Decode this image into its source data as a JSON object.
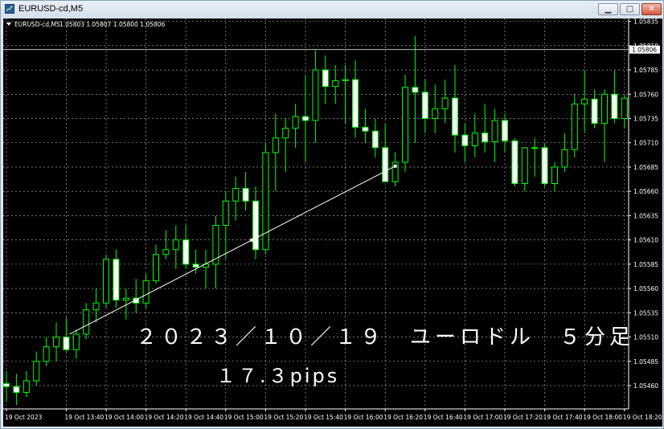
{
  "window": {
    "title": "EURUSD-cd,M5",
    "buttons": {
      "minimize": "▁",
      "maximize": "□",
      "close": "✕"
    }
  },
  "header": {
    "symbol": "EURUSD-cd,M5",
    "ohlc": "1.05803 1.05807 1.05800 1.05806"
  },
  "current_price": "1.05806",
  "annotation": {
    "title": "２０２３／１０／１９　ユーロドル　５分足",
    "pips": "１７.３pips"
  },
  "colors": {
    "background": "#000000",
    "candle_border": "#00ff00",
    "bull_body": "#000000",
    "bear_body": "#ffffff",
    "grid": "#c0c0c0",
    "axis_text": "#ffffff",
    "price_line": "#c0c0c0",
    "trend_line": "#ffffff"
  },
  "chart_data": {
    "type": "candlestick",
    "timeframe": "M5",
    "y_ticks": [
      "1.05460",
      "1.05485",
      "1.05510",
      "1.05535",
      "1.05560",
      "1.05585",
      "1.05610",
      "1.05635",
      "1.05660",
      "1.05685",
      "1.05710",
      "1.05735",
      "1.05760",
      "1.05785",
      "1.05810",
      "1.05835"
    ],
    "ylim": [
      1.05436,
      1.05838
    ],
    "x_labels": [
      "19 Oct 2023",
      "19 Oct 13:40",
      "19 Oct 14:00",
      "19 Oct 14:20",
      "19 Oct 14:40",
      "19 Oct 15:00",
      "19 Oct 15:20",
      "19 Oct 15:40",
      "19 Oct 16:00",
      "19 Oct 16:20",
      "19 Oct 16:40",
      "19 Oct 17:00",
      "19 Oct 17:20",
      "19 Oct 17:40",
      "19 Oct 18:00",
      "19 Oct 18:20"
    ],
    "x_label_candle_index": [
      0,
      6,
      10,
      14,
      18,
      22,
      26,
      30,
      34,
      38,
      42,
      46,
      50,
      54,
      58,
      62
    ],
    "grid": true,
    "candles": [
      {
        "o": 1.05462,
        "h": 1.05475,
        "l": 1.05443,
        "c": 1.05459
      },
      {
        "o": 1.05459,
        "h": 1.05472,
        "l": 1.0544,
        "c": 1.05453
      },
      {
        "o": 1.05453,
        "h": 1.05475,
        "l": 1.05448,
        "c": 1.05465
      },
      {
        "o": 1.05465,
        "h": 1.05495,
        "l": 1.0546,
        "c": 1.05485
      },
      {
        "o": 1.05485,
        "h": 1.0551,
        "l": 1.0548,
        "c": 1.055
      },
      {
        "o": 1.055,
        "h": 1.05525,
        "l": 1.05485,
        "c": 1.0551
      },
      {
        "o": 1.0551,
        "h": 1.0553,
        "l": 1.05495,
        "c": 1.05497
      },
      {
        "o": 1.05497,
        "h": 1.05518,
        "l": 1.05488,
        "c": 1.05513
      },
      {
        "o": 1.05513,
        "h": 1.05545,
        "l": 1.05508,
        "c": 1.05538
      },
      {
        "o": 1.05538,
        "h": 1.0556,
        "l": 1.05525,
        "c": 1.05545
      },
      {
        "o": 1.05545,
        "h": 1.05595,
        "l": 1.0554,
        "c": 1.0559
      },
      {
        "o": 1.0559,
        "h": 1.056,
        "l": 1.0554,
        "c": 1.05548
      },
      {
        "o": 1.05548,
        "h": 1.0556,
        "l": 1.05528,
        "c": 1.0555
      },
      {
        "o": 1.0555,
        "h": 1.0557,
        "l": 1.05535,
        "c": 1.05545
      },
      {
        "o": 1.05545,
        "h": 1.05575,
        "l": 1.0554,
        "c": 1.05568
      },
      {
        "o": 1.05568,
        "h": 1.05605,
        "l": 1.05565,
        "c": 1.05595
      },
      {
        "o": 1.05595,
        "h": 1.0562,
        "l": 1.0559,
        "c": 1.056
      },
      {
        "o": 1.056,
        "h": 1.05625,
        "l": 1.0558,
        "c": 1.0561
      },
      {
        "o": 1.0561,
        "h": 1.05625,
        "l": 1.0558,
        "c": 1.05585
      },
      {
        "o": 1.05585,
        "h": 1.056,
        "l": 1.05575,
        "c": 1.05582
      },
      {
        "o": 1.05582,
        "h": 1.056,
        "l": 1.0556,
        "c": 1.05585
      },
      {
        "o": 1.05585,
        "h": 1.05635,
        "l": 1.0556,
        "c": 1.05625
      },
      {
        "o": 1.05625,
        "h": 1.0566,
        "l": 1.0559,
        "c": 1.0565
      },
      {
        "o": 1.0565,
        "h": 1.05675,
        "l": 1.0563,
        "c": 1.05663
      },
      {
        "o": 1.05663,
        "h": 1.0568,
        "l": 1.0564,
        "c": 1.0565
      },
      {
        "o": 1.0565,
        "h": 1.05665,
        "l": 1.0559,
        "c": 1.056
      },
      {
        "o": 1.056,
        "h": 1.0571,
        "l": 1.05595,
        "c": 1.057
      },
      {
        "o": 1.057,
        "h": 1.0574,
        "l": 1.0566,
        "c": 1.05715
      },
      {
        "o": 1.05715,
        "h": 1.05735,
        "l": 1.0568,
        "c": 1.05725
      },
      {
        "o": 1.05725,
        "h": 1.0575,
        "l": 1.05705,
        "c": 1.05737
      },
      {
        "o": 1.05737,
        "h": 1.0578,
        "l": 1.0569,
        "c": 1.05733
      },
      {
        "o": 1.05733,
        "h": 1.05805,
        "l": 1.0571,
        "c": 1.05785
      },
      {
        "o": 1.05785,
        "h": 1.058,
        "l": 1.0575,
        "c": 1.05768
      },
      {
        "o": 1.05768,
        "h": 1.0579,
        "l": 1.0575,
        "c": 1.05774
      },
      {
        "o": 1.05774,
        "h": 1.0579,
        "l": 1.0573,
        "c": 1.05775
      },
      {
        "o": 1.05775,
        "h": 1.05795,
        "l": 1.05715,
        "c": 1.05726
      },
      {
        "o": 1.05726,
        "h": 1.05745,
        "l": 1.0571,
        "c": 1.05722
      },
      {
        "o": 1.05722,
        "h": 1.05735,
        "l": 1.05695,
        "c": 1.05705
      },
      {
        "o": 1.05705,
        "h": 1.0573,
        "l": 1.05685,
        "c": 1.0567
      },
      {
        "o": 1.0567,
        "h": 1.057,
        "l": 1.05665,
        "c": 1.0569
      },
      {
        "o": 1.0569,
        "h": 1.0578,
        "l": 1.0568,
        "c": 1.05767
      },
      {
        "o": 1.05767,
        "h": 1.0582,
        "l": 1.0571,
        "c": 1.05762
      },
      {
        "o": 1.05762,
        "h": 1.05775,
        "l": 1.0572,
        "c": 1.05735
      },
      {
        "o": 1.05735,
        "h": 1.0577,
        "l": 1.0572,
        "c": 1.05745
      },
      {
        "o": 1.05745,
        "h": 1.05775,
        "l": 1.0573,
        "c": 1.05756
      },
      {
        "o": 1.05756,
        "h": 1.0579,
        "l": 1.057,
        "c": 1.05718
      },
      {
        "o": 1.05718,
        "h": 1.0573,
        "l": 1.0569,
        "c": 1.05707
      },
      {
        "o": 1.05707,
        "h": 1.0574,
        "l": 1.05695,
        "c": 1.0572
      },
      {
        "o": 1.0572,
        "h": 1.0575,
        "l": 1.057,
        "c": 1.05711
      },
      {
        "o": 1.05711,
        "h": 1.05745,
        "l": 1.0569,
        "c": 1.05733
      },
      {
        "o": 1.05733,
        "h": 1.0574,
        "l": 1.057,
        "c": 1.05712
      },
      {
        "o": 1.05712,
        "h": 1.05715,
        "l": 1.05665,
        "c": 1.05668
      },
      {
        "o": 1.05668,
        "h": 1.057,
        "l": 1.0566,
        "c": 1.05705
      },
      {
        "o": 1.05705,
        "h": 1.05715,
        "l": 1.05675,
        "c": 1.05705
      },
      {
        "o": 1.05705,
        "h": 1.0571,
        "l": 1.05665,
        "c": 1.05668
      },
      {
        "o": 1.05668,
        "h": 1.0569,
        "l": 1.0566,
        "c": 1.05685
      },
      {
        "o": 1.05685,
        "h": 1.0572,
        "l": 1.0568,
        "c": 1.05703
      },
      {
        "o": 1.05703,
        "h": 1.0576,
        "l": 1.05695,
        "c": 1.0575
      },
      {
        "o": 1.0575,
        "h": 1.05785,
        "l": 1.0572,
        "c": 1.05755
      },
      {
        "o": 1.05755,
        "h": 1.05765,
        "l": 1.05725,
        "c": 1.0573
      },
      {
        "o": 1.0573,
        "h": 1.05765,
        "l": 1.0569,
        "c": 1.0576
      },
      {
        "o": 1.0576,
        "h": 1.05785,
        "l": 1.0573,
        "c": 1.05735
      },
      {
        "o": 1.05735,
        "h": 1.0576,
        "l": 1.05725,
        "c": 1.05756
      }
    ],
    "trend_line": {
      "from_index": 6,
      "from_price": 1.05513,
      "to_index": 39,
      "to_price": 1.05686
    }
  }
}
